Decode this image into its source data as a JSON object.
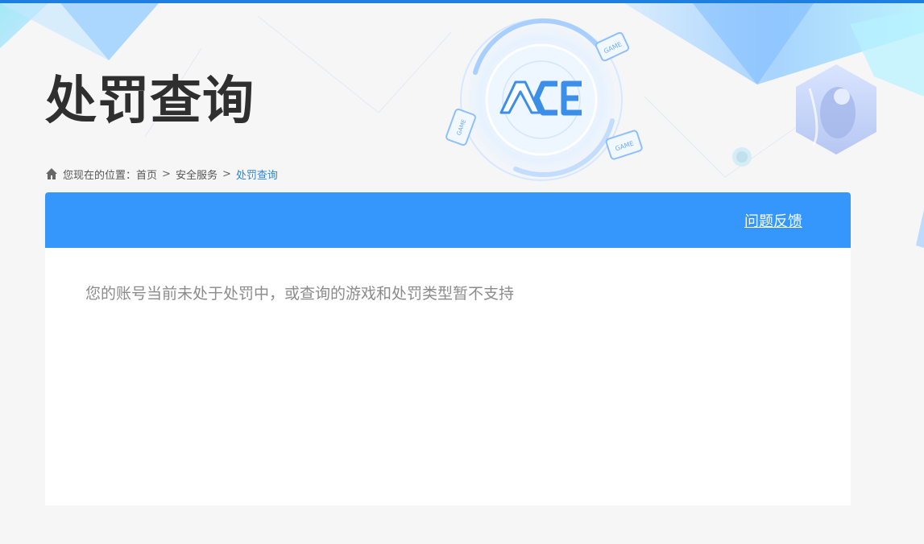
{
  "header": {
    "title": "处罚查询",
    "logo_text": "ACE",
    "game_badges": [
      "GAME",
      "GAME",
      "GAME"
    ]
  },
  "breadcrumb": {
    "prefix": "您现在的位置：",
    "items": [
      "首页",
      "安全服务",
      "处罚查询"
    ],
    "separator": ">"
  },
  "panel": {
    "feedback_label": "问题反馈",
    "message": "您的账号当前未处于处罚中，或查询的游戏和处罚类型暂不支持"
  },
  "colors": {
    "accent": "#3597fb",
    "top_strip": "#1e7fe0",
    "breadcrumb_current": "#2a86d8",
    "title": "#2f2f2f",
    "message": "#8b8b8b"
  }
}
